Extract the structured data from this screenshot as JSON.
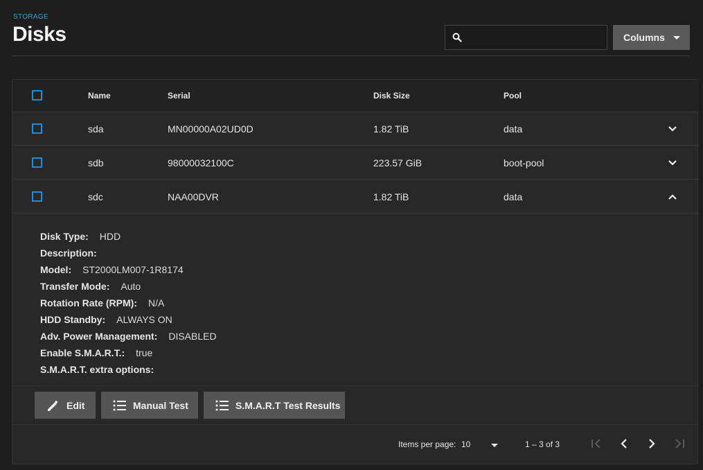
{
  "header": {
    "breadcrumb": "STORAGE",
    "title": "Disks",
    "search_placeholder": "",
    "columns_label": "Columns"
  },
  "table": {
    "columns": [
      "Name",
      "Serial",
      "Disk Size",
      "Pool"
    ],
    "rows": [
      {
        "name": "sda",
        "serial": "MN00000A02UD0D",
        "size": "1.82 TiB",
        "pool": "data",
        "expanded": false
      },
      {
        "name": "sdb",
        "serial": "98000032100C",
        "size": "223.57 GiB",
        "pool": "boot-pool",
        "expanded": false
      },
      {
        "name": "sdc",
        "serial": "NAA00DVR",
        "size": "1.82 TiB",
        "pool": "data",
        "expanded": true
      }
    ]
  },
  "details": [
    {
      "label": "Disk Type:",
      "value": "HDD"
    },
    {
      "label": "Description:",
      "value": ""
    },
    {
      "label": "Model:",
      "value": "ST2000LM007-1R8174"
    },
    {
      "label": "Transfer Mode:",
      "value": "Auto"
    },
    {
      "label": "Rotation Rate (RPM):",
      "value": "N/A"
    },
    {
      "label": "HDD Standby:",
      "value": "ALWAYS ON"
    },
    {
      "label": "Adv. Power Management:",
      "value": "DISABLED"
    },
    {
      "label": "Enable S.M.A.R.T.:",
      "value": "true"
    },
    {
      "label": "S.M.A.R.T. extra options:",
      "value": ""
    }
  ],
  "actions": {
    "edit": "Edit",
    "manual_test": "Manual Test",
    "smart_results": "S.M.A.R.T Test Results"
  },
  "paginator": {
    "items_per_page_label": "Items per page:",
    "page_size": "10",
    "range": "1 – 3 of 3"
  },
  "colors": {
    "accent": "#1e8fd8",
    "background": "#1e1e1e",
    "card": "#282828",
    "button": "#555555"
  }
}
